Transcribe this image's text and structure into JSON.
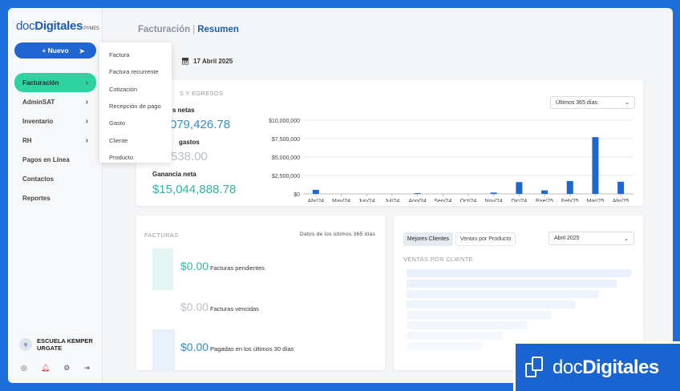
{
  "brand": {
    "logo_light": "doc",
    "logo_bold": "Digitales",
    "logo_suffix": "PYMES"
  },
  "sidebar": {
    "new_button": "+ Nuevo",
    "items": [
      {
        "label": "Facturación",
        "chevron": "›"
      },
      {
        "label": "AdminSAT",
        "chevron": "›"
      },
      {
        "label": "Inventario",
        "chevron": "›"
      },
      {
        "label": "RH",
        "chevron": "›"
      },
      {
        "label": "Pagos en Línea"
      },
      {
        "label": "Contactos"
      },
      {
        "label": "Reportes"
      }
    ],
    "user": {
      "name_line1": "ESCUELA KEMPER",
      "name_line2": "URGATE"
    }
  },
  "new_menu": [
    "Factura",
    "Factura recurrente",
    "Cotización",
    "Recepción de pago",
    "Gasto",
    "Cliente",
    "Producto"
  ],
  "header": {
    "section": "Facturación",
    "separator": "|",
    "page": "Resumen",
    "date": "17 Abril 2025"
  },
  "summary": {
    "label": "S Y EGRESOS",
    "period": "Últimos 365 días",
    "ventas_label": "s netas",
    "ventas_value": "079,426.78",
    "gastos_label": "gastos",
    "gastos_value": "538.00",
    "ganancia_label": "Ganancia neta",
    "ganancia_value": "$15,044,888.78"
  },
  "chart_data": {
    "type": "bar",
    "categories": [
      "Abr/24",
      "May/24",
      "Jun/24",
      "Jul/24",
      "Ago/24",
      "Sep/24",
      "Oct/24",
      "Nov/24",
      "Dic/24",
      "Ene/25",
      "Feb/25",
      "Mar/25",
      "Abr/25"
    ],
    "values": [
      550000,
      0,
      0,
      0,
      100000,
      0,
      0,
      180000,
      1600000,
      480000,
      1750000,
      7700000,
      1650000
    ],
    "yticks": [
      "$10,000,000",
      "$7,500,000",
      "$5,000,000",
      "$2,500,000",
      "$0"
    ],
    "ylim": [
      0,
      10000000
    ],
    "color": "#1f66d1",
    "grid": true
  },
  "facturas": {
    "label": "FACTURAS",
    "period": "Datos de los últimos 365 días",
    "rows": [
      {
        "amount": "$0.00",
        "text": "Facturas pendientes"
      },
      {
        "amount": "$0.00",
        "text": "Facturas vencidas"
      },
      {
        "amount": "$0.00",
        "text": "Pagadas en los últimos 30 días"
      }
    ]
  },
  "clientes": {
    "tabs": [
      "Mejores Clientes",
      "Ventas por Producto"
    ],
    "month": "Abril 2025",
    "label": "VENTAS POR CLIENTE"
  },
  "badge": {
    "light": "doc",
    "bold": "Digitales"
  },
  "colors": {
    "accent": "#1f66d1",
    "active": "#2ed3a0",
    "teal": "#2fb5a5",
    "frame": "#1e6fd9"
  }
}
